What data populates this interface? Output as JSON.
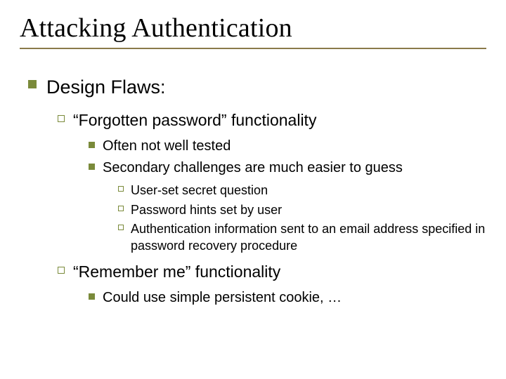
{
  "title": "Attacking Authentication",
  "l1": {
    "text": "Design Flaws:"
  },
  "l2a": {
    "text": "“Forgotten password” functionality"
  },
  "l3a": {
    "text": "Often not well tested"
  },
  "l3b": {
    "text": "Secondary challenges are much easier to guess"
  },
  "l4a": {
    "text": "User-set secret question"
  },
  "l4b": {
    "text": "Password hints set by user"
  },
  "l4c": {
    "text": "Authentication information sent to an email address specified in password recovery procedure"
  },
  "l2b": {
    "text": "“Remember me” functionality"
  },
  "l3c": {
    "text": "Could use simple persistent cookie, …"
  }
}
